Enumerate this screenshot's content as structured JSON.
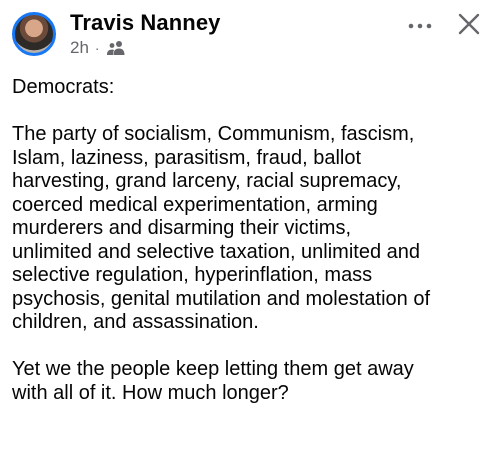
{
  "post": {
    "author": "Travis Nanney",
    "time": "2h",
    "separator": "·",
    "audience_icon": "friends-icon",
    "more_icon": "more-options-icon",
    "close_icon": "close-icon",
    "text": "Democrats:\n\nThe party of socialism, Communism, fascism,\nIslam, laziness, parasitism, fraud, ballot\nharvesting, grand larceny, racial supremacy,\ncoerced medical experimentation, arming\nmurderers and disarming their victims,\nunlimited and selective taxation, unlimited and\nselective regulation, hyperinflation, mass\npsychosis, genital mutilation and molestation of\nchildren, and assassination.\n\nYet we the people keep letting them get away\nwith all of it. How much longer?"
  }
}
